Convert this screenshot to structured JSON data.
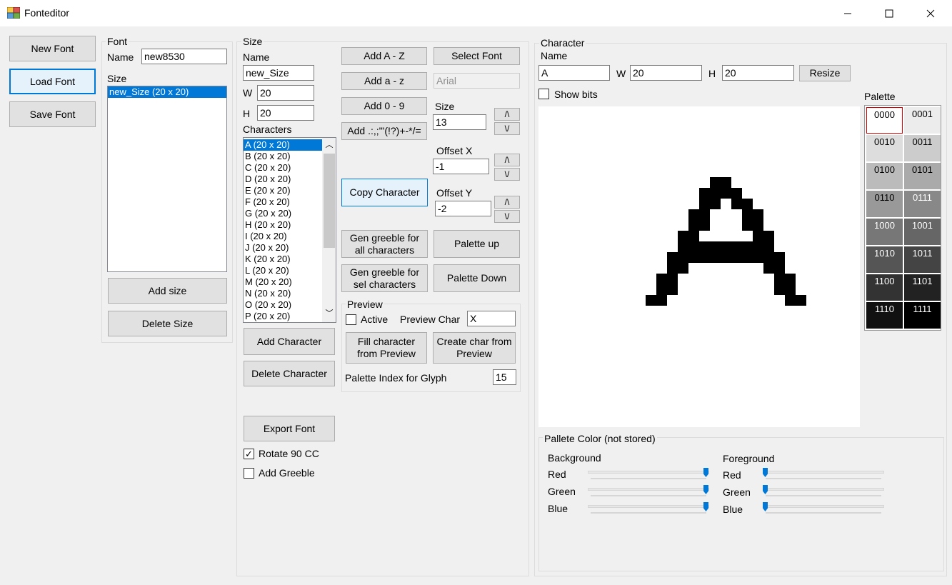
{
  "window": {
    "title": "Fonteditor",
    "minimize": "—",
    "maximize": "☐",
    "close": "✕"
  },
  "left_buttons": {
    "new_font": "New Font",
    "load_font": "Load Font",
    "save_font": "Save Font"
  },
  "font_group": {
    "title": "Font",
    "name_label": "Name",
    "name_value": "new8530",
    "size_label": "Size",
    "sizes": [
      "new_Size (20 x 20)"
    ],
    "add_size": "Add size",
    "delete_size": "Delete Size"
  },
  "size_group": {
    "title": "Size",
    "name_label": "Name",
    "name_value": "new_Size",
    "w_label": "W",
    "w_value": "20",
    "h_label": "H",
    "h_value": "20",
    "characters_label": "Characters",
    "characters": [
      "A (20 x 20)",
      "B (20 x 20)",
      "C (20 x 20)",
      "D (20 x 20)",
      "E (20 x 20)",
      "F (20 x 20)",
      "G (20 x 20)",
      "H (20 x 20)",
      "I (20 x 20)",
      "J (20 x 20)",
      "K (20 x 20)",
      "L (20 x 20)",
      "M (20 x 20)",
      "N (20 x 20)",
      "O (20 x 20)",
      "P (20 x 20)"
    ],
    "add_character": "Add Character",
    "delete_character": "Delete Character",
    "export_font": "Export Font",
    "rotate_label": "Rotate 90 CC",
    "add_greeble_label": "Add Greeble"
  },
  "tools": {
    "add_az_upper": "Add A - Z",
    "add_az_lower": "Add a - z",
    "add_09": "Add 0 - 9",
    "add_symbols": "Add .:,;'\"(!?)+-*/=",
    "select_font": "Select Font",
    "font_name": "Arial",
    "size_label": "Size",
    "size_value": "13",
    "offset_x_label": "Offset X",
    "offset_x_value": "-1",
    "offset_y_label": "Offset Y",
    "offset_y_value": "-2",
    "up": "/\\",
    "down": "\\/",
    "copy_character": "Copy Character",
    "gen_greeble_all": "Gen greeble for all characters",
    "gen_greeble_sel": "Gen greeble for sel characters",
    "palette_up": "Palette up",
    "palette_down": "Palette Down"
  },
  "preview": {
    "title": "Preview",
    "active_label": "Active",
    "preview_char_label": "Preview Char",
    "preview_char_value": "X",
    "fill_from_preview": "Fill character from Preview",
    "create_from_preview": "Create char from Preview",
    "palette_index_label": "Palette Index for Glyph",
    "palette_index_value": "15"
  },
  "character": {
    "title": "Character",
    "name_label": "Name",
    "name_value": "A",
    "w_label": "W",
    "w_value": "20",
    "h_label": "H",
    "h_value": "20",
    "resize": "Resize",
    "show_bits_label": "Show bits",
    "bitmap": [
      "....................",
      "....................",
      "....................",
      "....................",
      "....................",
      "....................",
      "....................",
      "........##..........",
      ".......####.........",
      ".......##.##........",
      "......##...##.......",
      "......##...##.......",
      ".....##.....##......",
      ".....#########......",
      "....###########.....",
      "....##.......##.....",
      "...##.........##....",
      "...##.........##....",
      "..##...........##...",
      "....................",
      "...................."
    ]
  },
  "palette": {
    "title": "Palette",
    "entries": [
      {
        "code": "0000",
        "color": "#ffffff"
      },
      {
        "code": "0001",
        "color": "#ececec"
      },
      {
        "code": "0010",
        "color": "#dddddd"
      },
      {
        "code": "0011",
        "color": "#cccccc"
      },
      {
        "code": "0100",
        "color": "#bbbbbb"
      },
      {
        "code": "0101",
        "color": "#aaaaaa"
      },
      {
        "code": "0110",
        "color": "#999999"
      },
      {
        "code": "0111",
        "color": "#888888"
      },
      {
        "code": "1000",
        "color": "#777777"
      },
      {
        "code": "1001",
        "color": "#666666"
      },
      {
        "code": "1010",
        "color": "#555555"
      },
      {
        "code": "1011",
        "color": "#444444"
      },
      {
        "code": "1100",
        "color": "#333333"
      },
      {
        "code": "1101",
        "color": "#222222"
      },
      {
        "code": "1110",
        "color": "#111111"
      },
      {
        "code": "1111",
        "color": "#000000"
      }
    ]
  },
  "pallete_color": {
    "title": "Pallete Color (not stored)",
    "background_label": "Background",
    "foreground_label": "Foreground",
    "red_label": "Red",
    "green_label": "Green",
    "blue_label": "Blue",
    "background": {
      "red": 1.0,
      "green": 1.0,
      "blue": 1.0
    },
    "foreground": {
      "red": 0.0,
      "green": 0.0,
      "blue": 0.0
    }
  }
}
